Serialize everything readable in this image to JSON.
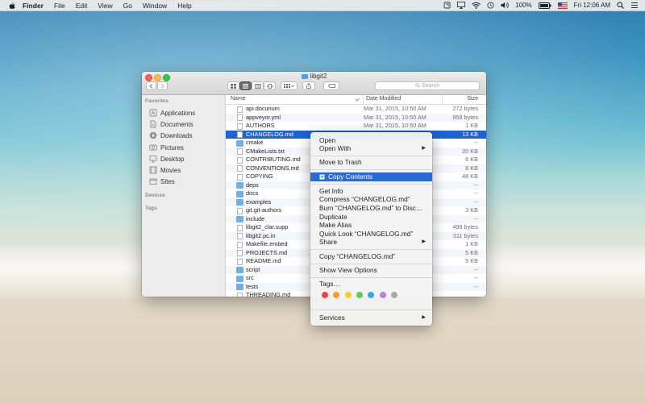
{
  "menubar": {
    "app": "Finder",
    "items": [
      "File",
      "Edit",
      "View",
      "Go",
      "Window",
      "Help"
    ],
    "battery": "100%",
    "clock": "Fri 12:06 AM"
  },
  "window": {
    "title": "libgit2",
    "search_placeholder": "Search",
    "sidebar": {
      "favorites_header": "Favorites",
      "favorites": [
        "Applications",
        "Documents",
        "Downloads",
        "Pictures",
        "Desktop",
        "Movies",
        "Sites"
      ],
      "devices_header": "Devices",
      "tags_header": "Tags"
    },
    "columns": {
      "name": "Name",
      "date": "Date Modified",
      "size": "Size"
    },
    "files": [
      {
        "name": "api.docurium",
        "date": "Mar 31, 2015, 10:50 AM",
        "size": "272 bytes",
        "kind": "doc"
      },
      {
        "name": "appveyor.yml",
        "date": "Mar 31, 2015, 10:50 AM",
        "size": "958 bytes",
        "kind": "doc"
      },
      {
        "name": "AUTHORS",
        "date": "Mar 31, 2015, 10:50 AM",
        "size": "1 KB",
        "kind": "doc"
      },
      {
        "name": "CHANGELOG.md",
        "date": "",
        "size": "13 KB",
        "kind": "doc"
      },
      {
        "name": "cmake",
        "date": "",
        "size": "--",
        "kind": "folder"
      },
      {
        "name": "CMakeLists.txt",
        "date": "",
        "size": "20 KB",
        "kind": "doc"
      },
      {
        "name": "CONTRIBUTING.md",
        "date": "",
        "size": "6 KB",
        "kind": "doc"
      },
      {
        "name": "CONVENTIONS.md",
        "date": "",
        "size": "8 KB",
        "kind": "doc"
      },
      {
        "name": "COPYING",
        "date": "",
        "size": "48 KB",
        "kind": "doc"
      },
      {
        "name": "deps",
        "date": "",
        "size": "--",
        "kind": "folder"
      },
      {
        "name": "docs",
        "date": "",
        "size": "--",
        "kind": "folder"
      },
      {
        "name": "examples",
        "date": "",
        "size": "--",
        "kind": "folder"
      },
      {
        "name": "git.git-authors",
        "date": "",
        "size": "3 KB",
        "kind": "doc"
      },
      {
        "name": "include",
        "date": "",
        "size": "--",
        "kind": "folder"
      },
      {
        "name": "libgit2_clar.supp",
        "date": "",
        "size": "498 bytes",
        "kind": "doc"
      },
      {
        "name": "libgit2.pc.in",
        "date": "",
        "size": "311 bytes",
        "kind": "doc"
      },
      {
        "name": "Makefile.embed",
        "date": "",
        "size": "1 KB",
        "kind": "doc"
      },
      {
        "name": "PROJECTS.md",
        "date": "",
        "size": "5 KB",
        "kind": "doc"
      },
      {
        "name": "README.md",
        "date": "",
        "size": "9 KB",
        "kind": "doc"
      },
      {
        "name": "script",
        "date": "",
        "size": "--",
        "kind": "folder"
      },
      {
        "name": "src",
        "date": "",
        "size": "--",
        "kind": "folder"
      },
      {
        "name": "tests",
        "date": "",
        "size": "--",
        "kind": "folder"
      },
      {
        "name": "THREADING.md",
        "date": "",
        "size": "",
        "kind": "doc"
      }
    ],
    "selected_index": 3
  },
  "context_menu": {
    "open": "Open",
    "open_with": "Open With",
    "move_to_trash": "Move to Trash",
    "copy_contents": "Copy Contents",
    "get_info": "Get Info",
    "compress": "Compress “CHANGELOG.md”",
    "burn": "Burn “CHANGELOG.md” to Disc…",
    "duplicate": "Duplicate",
    "make_alias": "Make Alias",
    "quick_look": "Quick Look “CHANGELOG.md”",
    "share": "Share",
    "copy": "Copy “CHANGELOG.md”",
    "show_view_options": "Show View Options",
    "tags": "Tags…",
    "services": "Services",
    "tag_colors": [
      "#ee4444",
      "#f5a021",
      "#f5d028",
      "#5fce4f",
      "#3ba4ee",
      "#c97bdc",
      "#a9a9a9"
    ]
  }
}
